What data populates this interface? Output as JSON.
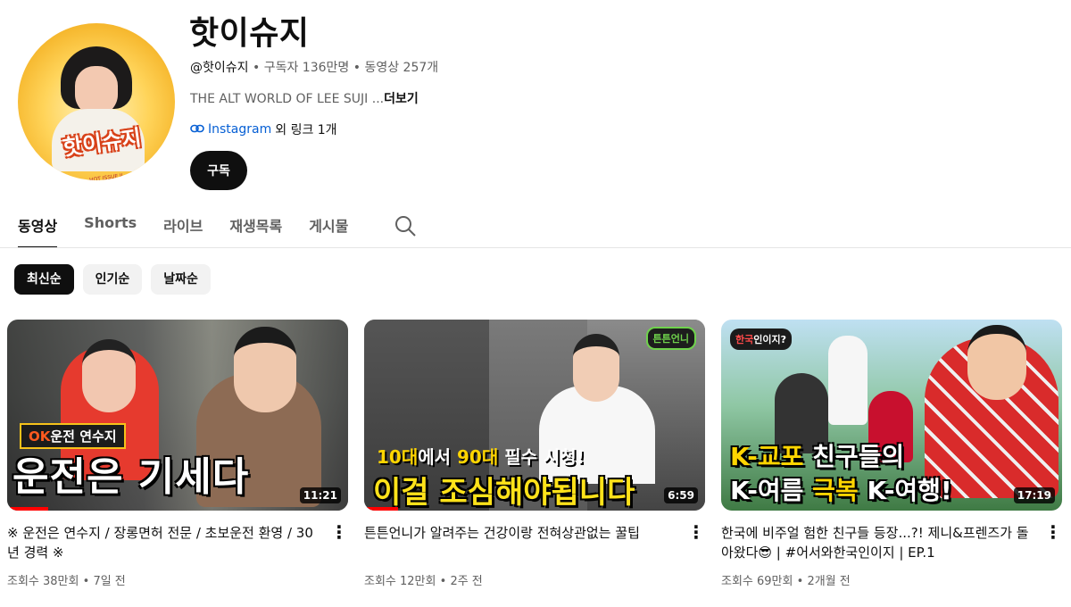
{
  "channel": {
    "name": "핫이슈지",
    "handle": "@핫이슈지",
    "subscribers": "구독자 136만명",
    "videos": "동영상 257개",
    "sep": "•",
    "description": "THE ALT WORLD OF LEE SUJI ...",
    "more": "더보기",
    "link_name": "Instagram",
    "link_extra": "외 링크 1개",
    "avatar_logo": "핫이슈지",
    "avatar_logo_sub": "HOT ISSUE JI",
    "subscribe_label": "구독",
    "link_icon": "link-icon"
  },
  "tabs": [
    {
      "label": "동영상",
      "active": true
    },
    {
      "label": "Shorts"
    },
    {
      "label": "라이브"
    },
    {
      "label": "재생목록"
    },
    {
      "label": "게시물"
    }
  ],
  "chips": [
    {
      "label": "최신순",
      "active": true
    },
    {
      "label": "인기순"
    },
    {
      "label": "날짜순"
    }
  ],
  "videos": [
    {
      "title": "※ 운전은 연수지 / 장롱면허 전문 / 초보운전 환영 / 30년 경력 ※",
      "views": "조회수 38만회",
      "age": "7일 전",
      "duration": "11:21",
      "progress": 0.12,
      "thumb_tag_ok": "OK",
      "thumb_tag": "운전 연수지",
      "thumb_big": "운전은 기세다"
    },
    {
      "title": "튼튼언니가 알려주는 건강이랑 전혀상관없는 꿀팁",
      "views": "조회수 12만회",
      "age": "2주 전",
      "duration": "6:59",
      "progress": 0.1,
      "thumb_logo": "튼튼언니",
      "thumb_sub_a": "10대",
      "thumb_sub_b": "에서 ",
      "thumb_sub_c": "90대",
      "thumb_sub_d": " 필수 시청!",
      "thumb_big": "이걸 조심해야됩니다"
    },
    {
      "title": "한국에 비주얼 험한 친구들 등장...?! 제니&프렌즈가 돌아왔다😎 | #어서와한국인이지 | EP.1",
      "views": "조회수 69만회",
      "age": "2개월 전",
      "duration": "17:19",
      "thumb_logo_a": "한국",
      "thumb_logo_b": "인이지?",
      "thumb_l1_a": "K-교포 ",
      "thumb_l1_b": "친구들의",
      "thumb_l2_a": "K-여름 ",
      "thumb_l2_b": "극복 ",
      "thumb_l2_c": "K-여행!"
    }
  ],
  "colors": {
    "accent": "#0f0f0f",
    "link": "#065fd4",
    "progress": "#ff0000"
  }
}
